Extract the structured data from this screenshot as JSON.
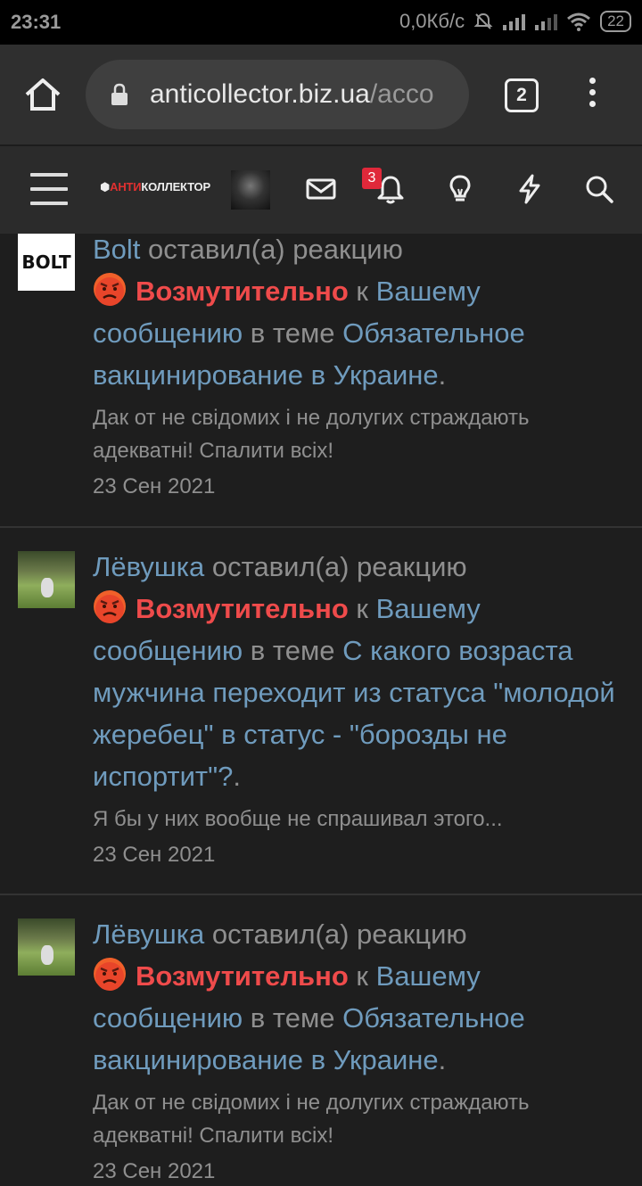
{
  "status_bar": {
    "time": "23:31",
    "speed": "0,0Кб/с",
    "battery": "22"
  },
  "browser": {
    "url_main": "anticollector.biz.ua",
    "url_rest": "/acco",
    "tab_count": "2"
  },
  "site_header": {
    "logo_left": "АНТИ",
    "logo_right": "КОЛЛЕКТОР",
    "notification_count": "3"
  },
  "feed": [
    {
      "user": "Bolt",
      "avatar_text": "BOLT",
      "action": " оставил(а) реакцию",
      "reaction": "Возмутительно",
      "to": " к ",
      "target": "Вашему сообщению",
      "in_thread": " в теме ",
      "thread": "Обязательное вакцинирование в Украине",
      "end": ".",
      "snippet": "Дак от не свідомих і не долугих страждають адекватні! Спалити всіх!",
      "date": "23 Сен 2021"
    },
    {
      "user": "Лёвушка",
      "action": " оставил(а) реакцию",
      "reaction": "Возмутительно",
      "to": " к ",
      "target": "Вашему сообщению",
      "in_thread": " в теме ",
      "thread": "С какого возраста мужчина переходит из статуса \"молодой жеребец\" в статус - \"борозды не испортит\"?",
      "end": ".",
      "snippet": "Я бы у них вообще не спрашивал этого...",
      "date": "23 Сен 2021"
    },
    {
      "user": "Лёвушка",
      "action": " оставил(а) реакцию",
      "reaction": "Возмутительно",
      "to": " к ",
      "target": "Вашему сообщению",
      "in_thread": " в теме ",
      "thread": "Обязательное вакцинирование в Украине",
      "end": ".",
      "snippet": "Дак от не свідомих і не долугих страждають адекватні! Спалити всіх!",
      "date": "23 Сен 2021"
    }
  ],
  "colors": {
    "link": "#6f9bbd",
    "reaction": "#ef4b4b",
    "background": "#1e1e1e"
  }
}
